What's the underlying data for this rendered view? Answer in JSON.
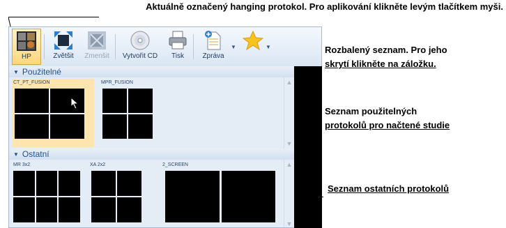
{
  "annotations": {
    "top": "Aktuálně označený hanging protokol. Pro aplikování klikněte levým tlačítkem myši.",
    "expanded_line1": "Rozbalený seznam. Pro jeho",
    "expanded_line2": "skrytí klikněte na záložku.",
    "used_line1": "Seznam použitelných",
    "used_line2": "protokolů pro načtené studie",
    "other": "Seznam ostatních protokolů"
  },
  "toolbar": {
    "hp": "HP",
    "enlarge": "Zvětšit",
    "shrink": "Zmenšit",
    "create_cd": "Vytvořit CD",
    "print": "Tisk",
    "report": "Zpráva"
  },
  "sections": {
    "used": {
      "title": "Použitelné",
      "protocols": [
        {
          "name": "CT_PT_FUSION",
          "selected": true
        },
        {
          "name": "MPR_FUSION",
          "selected": false
        }
      ]
    },
    "other": {
      "title": "Ostatní",
      "protocols": [
        {
          "name": "MR 3x2"
        },
        {
          "name": "XA 2x2"
        },
        {
          "name": "2_SCREEN"
        }
      ]
    }
  },
  "colors": {
    "selected_bg": "#fde5ad",
    "header_text": "#1e4f91",
    "panel_bg": "#e4ecf6"
  }
}
